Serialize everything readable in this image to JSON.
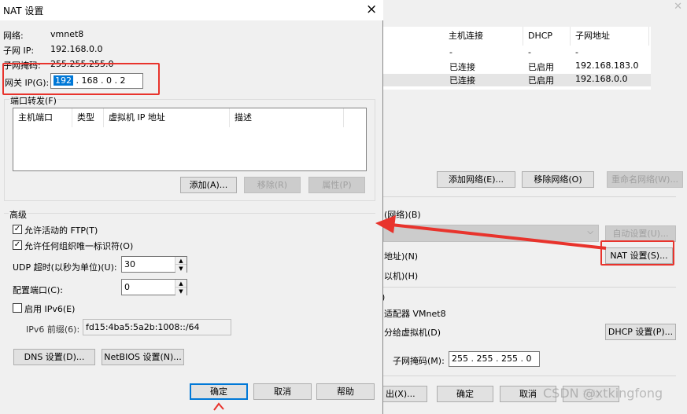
{
  "dialog": {
    "title": "NAT 设置",
    "close": "×",
    "network_label": "网络:",
    "network_value": "vmnet8",
    "subnet_ip_label": "子网 IP:",
    "subnet_ip_value": "192.168.0.0",
    "subnet_mask_label": "子网掩码:",
    "subnet_mask_value": "255.255.255.0",
    "gateway_label": "网关 IP(G):",
    "gateway_octets": [
      "192",
      "168",
      "0",
      "2"
    ],
    "port_forward_label": "端口转发(F)",
    "port_table_headers": [
      "主机端口",
      "类型",
      "虚拟机 IP 地址",
      "描述"
    ],
    "add_button": "添加(A)...",
    "remove_button": "移除(R)",
    "properties_button": "属性(P)",
    "advanced_label": "高级",
    "allow_ftp": "允许活动的 FTP(T)",
    "allow_uid": "允许任何组织唯一标识符(O)",
    "udp_timeout_label": "UDP 超时(以秒为单位)(U):",
    "udp_timeout_value": "30",
    "config_port_label": "配置端口(C):",
    "config_port_value": "0",
    "enable_ipv6": "启用 IPv6(E)",
    "ipv6_prefix_label": "IPv6 前缀(6):",
    "ipv6_prefix_value": "fd15:4ba5:5a2b:1008::/64",
    "dns_button": "DNS 设置(D)...",
    "netbios_button": "NetBIOS 设置(N)...",
    "ok_button": "确定",
    "cancel_button": "取消",
    "help_button": "帮助"
  },
  "background": {
    "table_headers": [
      "主机连接",
      "DHCP",
      "子网地址"
    ],
    "rows": [
      [
        "-",
        "-",
        "-"
      ],
      [
        "已连接",
        "已启用",
        "192.168.183.0"
      ],
      [
        "已连接",
        "已启用",
        "192.168.0.0"
      ]
    ],
    "add_network": "添加网络(E)...",
    "remove_network": "移除网络(O)",
    "rename_network": "重命名网络(W)...",
    "nat_mode_fragment": "(网络)(B)",
    "auto_settings": "自动设置(U)...",
    "nat_settings": "NAT 设置(S)...",
    "address_fragment": "地址)(N)",
    "vm_fragment": "以机)(H)",
    "adapter_fragment": "适配器 VMnet8",
    "dhcp_fragment": "分给虚拟机(D)",
    "dhcp_settings": "DHCP 设置(P)...",
    "subnet_mask_label": "子网掩码(M):",
    "subnet_mask_octets": [
      "255",
      "255",
      "255",
      "0"
    ],
    "footer_partial": "出(X)...",
    "ok": "确定",
    "cancel": "取消",
    "help_partial": "帮助"
  },
  "watermark": "CSDN @xtkingfong",
  "colors": {
    "annotation_red": "#e8332c",
    "selection_blue": "#0078d7",
    "dialog_bg": "#f0f0f0"
  }
}
